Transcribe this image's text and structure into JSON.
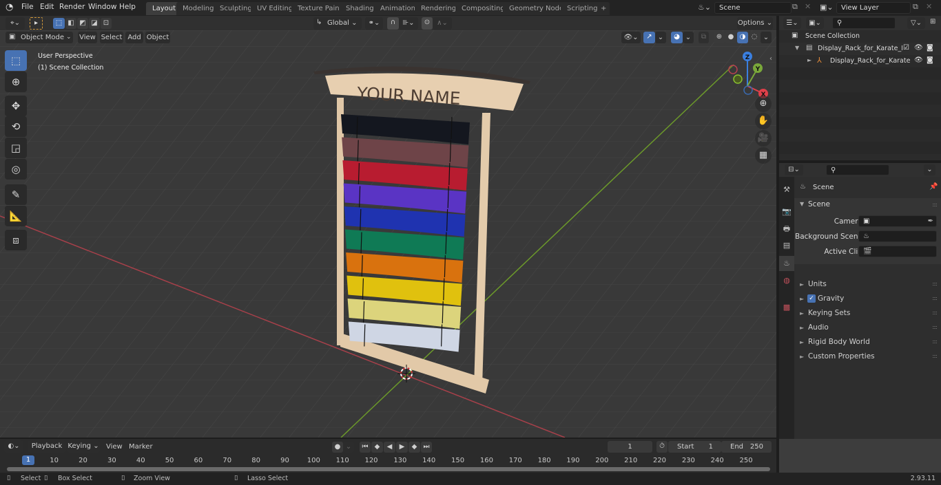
{
  "topbar": {
    "menus": [
      "File",
      "Edit",
      "Render",
      "Window",
      "Help"
    ],
    "workspaces": [
      "Layout",
      "Modeling",
      "Sculpting",
      "UV Editing",
      "Texture Paint",
      "Shading",
      "Animation",
      "Rendering",
      "Compositing",
      "Geometry Nodes",
      "Scripting"
    ],
    "active_workspace": "Layout",
    "add_tab": "+",
    "scene_name": "Scene",
    "view_layer": "View Layer"
  },
  "viewport_header": {
    "mode": "Object Mode",
    "menus": [
      "View",
      "Select",
      "Add",
      "Object"
    ],
    "transform_orientation": "Global",
    "options_label": "Options"
  },
  "viewport": {
    "view_name": "User Perspective",
    "collection_info": "(1) Scene Collection",
    "object_text": "YOUR NAME",
    "gizmo_axes": [
      "Z",
      "Y",
      "X"
    ],
    "belt_colors": [
      "#14171f",
      "#6e4448",
      "#b81c30",
      "#5a34c4",
      "#1f33b0",
      "#0f7a55",
      "#d9720e",
      "#e0c10e",
      "#dcd47c",
      "#cfd6e4"
    ],
    "wood_color": "#e7cfb0"
  },
  "tools": [
    "select-box",
    "cursor",
    "move",
    "rotate",
    "scale",
    "transform",
    "annotate",
    "measure",
    "add-cube"
  ],
  "outliner": {
    "root": "Scene Collection",
    "items": [
      {
        "name": "Display_Rack_for_Karate_Belt",
        "type": "collection"
      },
      {
        "name": "Display_Rack_for_Karate",
        "type": "object"
      }
    ]
  },
  "properties": {
    "context": "Scene",
    "panel_title": "Scene",
    "fields": [
      {
        "label": "Camera",
        "value": ""
      },
      {
        "label": "Background Scene",
        "value": ""
      },
      {
        "label": "Active Clip",
        "value": ""
      }
    ],
    "sections": [
      "Units",
      "Gravity",
      "Keying Sets",
      "Audio",
      "Rigid Body World",
      "Custom Properties"
    ],
    "gravity_checked": true
  },
  "timeline": {
    "menus": [
      "Playback",
      "Keying",
      "View",
      "Marker"
    ],
    "current_frame": "1",
    "start_label": "Start",
    "start": "1",
    "end_label": "End",
    "end": "250",
    "ticks": [
      "10",
      "20",
      "30",
      "40",
      "50",
      "60",
      "70",
      "80",
      "90",
      "100",
      "110",
      "120",
      "130",
      "140",
      "150",
      "160",
      "170",
      "180",
      "190",
      "200",
      "210",
      "220",
      "230",
      "240",
      "250"
    ],
    "playhead": "1"
  },
  "statusbar": {
    "hints": [
      "Select",
      "Box Select",
      "Zoom View",
      "Lasso Select"
    ],
    "version": "2.93.11"
  }
}
